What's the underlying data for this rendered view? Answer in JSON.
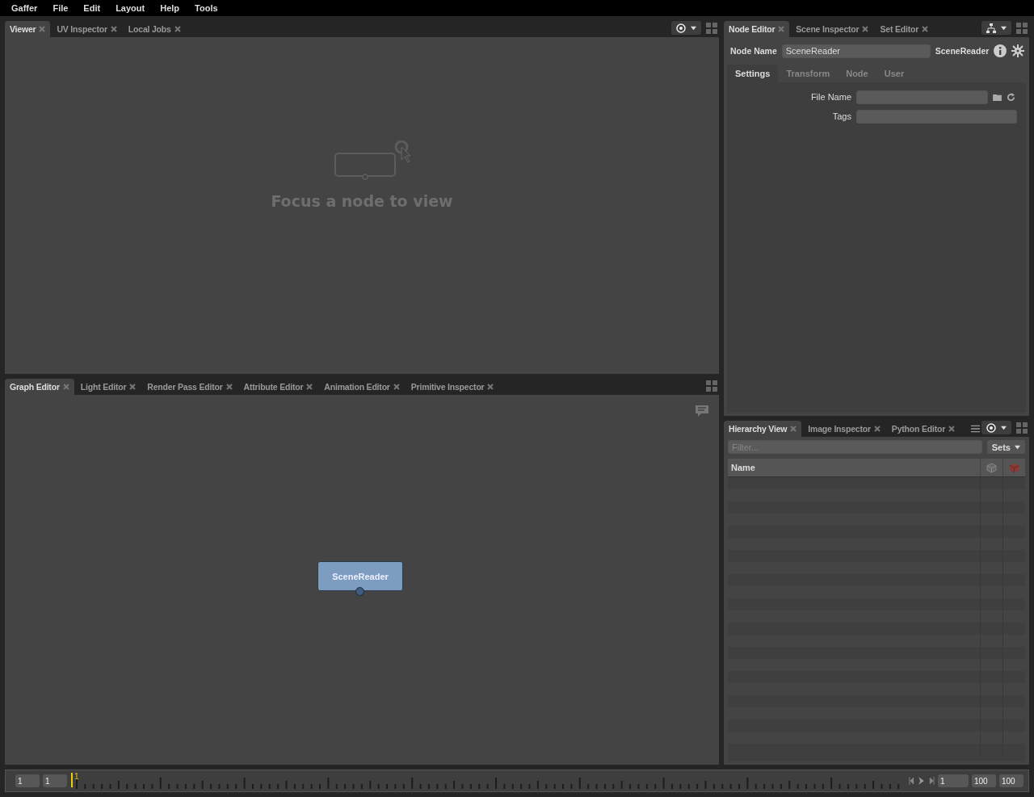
{
  "menu": [
    "Gaffer",
    "File",
    "Edit",
    "Layout",
    "Help",
    "Tools"
  ],
  "viewer": {
    "tabs": [
      {
        "label": "Viewer",
        "selected": true
      },
      {
        "label": "UV Inspector",
        "selected": false
      },
      {
        "label": "Local Jobs",
        "selected": false
      }
    ],
    "message": "Focus a node to view"
  },
  "graph_editor": {
    "tabs": [
      {
        "label": "Graph Editor",
        "selected": true
      },
      {
        "label": "Light Editor",
        "selected": false
      },
      {
        "label": "Render Pass Editor",
        "selected": false
      },
      {
        "label": "Attribute Editor",
        "selected": false
      },
      {
        "label": "Animation Editor",
        "selected": false
      },
      {
        "label": "Primitive Inspector",
        "selected": false
      }
    ],
    "nodes": [
      {
        "label": "SceneReader"
      }
    ]
  },
  "node_editor": {
    "tabs": [
      {
        "label": "Node Editor",
        "selected": true
      },
      {
        "label": "Scene Inspector",
        "selected": false
      },
      {
        "label": "Set Editor",
        "selected": false
      }
    ],
    "name_label": "Node Name",
    "name_value": "SceneReader",
    "node_type": "SceneReader",
    "sections": [
      {
        "label": "Settings",
        "selected": true
      },
      {
        "label": "Transform",
        "selected": false
      },
      {
        "label": "Node",
        "selected": false
      },
      {
        "label": "User",
        "selected": false
      }
    ],
    "fields": [
      {
        "label": "File Name",
        "kind": "file"
      },
      {
        "label": "Tags",
        "kind": "text"
      }
    ]
  },
  "hierarchy": {
    "tabs": [
      {
        "label": "Hierarchy View",
        "selected": true
      },
      {
        "label": "Image Inspector",
        "selected": false
      },
      {
        "label": "Python Editor",
        "selected": false
      }
    ],
    "filter_placeholder": "Filter...",
    "sets_button": "Sets",
    "columns": [
      {
        "label": "Name"
      }
    ]
  },
  "timeline": {
    "start": "1",
    "range_start": "1",
    "marker": "1",
    "current": "1",
    "range_end": "100",
    "end": "100"
  }
}
